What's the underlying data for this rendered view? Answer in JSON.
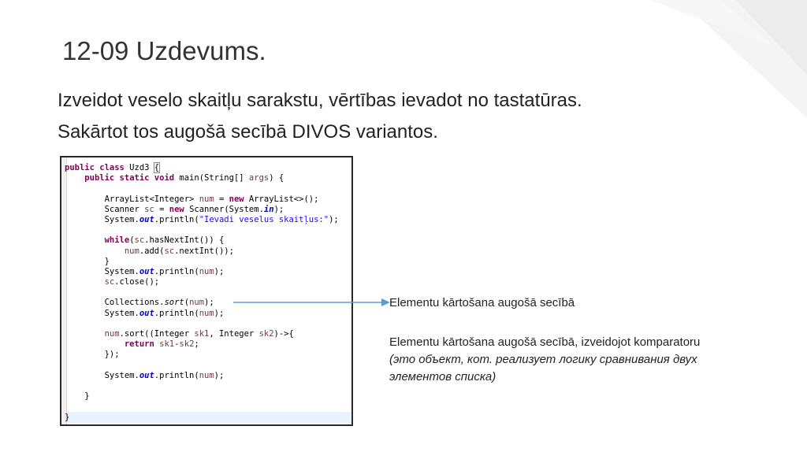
{
  "slide": {
    "title": "12-09 Uzdevums.",
    "paragraphs": [
      "Izveidot veselo skaitļu sarakstu, vērtības ievadot no tastatūras.",
      "Sakārtot tos augošā secībā DIVOS variantos."
    ]
  },
  "code": {
    "lines": [
      [
        {
          "t": "public class",
          "c": "kw"
        },
        {
          "t": " Uzd3 "
        },
        {
          "t": "{",
          "c": "brk"
        }
      ],
      [
        {
          "t": "    "
        },
        {
          "t": "public static void",
          "c": "kw"
        },
        {
          "t": " main(String[] "
        },
        {
          "t": "args",
          "c": "var"
        },
        {
          "t": ") {"
        }
      ],
      [],
      [
        {
          "t": "        ArrayList<Integer> "
        },
        {
          "t": "num",
          "c": "var"
        },
        {
          "t": " = "
        },
        {
          "t": "new",
          "c": "kw"
        },
        {
          "t": " ArrayList<>();"
        }
      ],
      [
        {
          "t": "        Scanner "
        },
        {
          "t": "sc",
          "c": "var"
        },
        {
          "t": " = "
        },
        {
          "t": "new",
          "c": "kw"
        },
        {
          "t": " Scanner(System."
        },
        {
          "t": "in",
          "c": "fld"
        },
        {
          "t": ");"
        }
      ],
      [
        {
          "t": "        System."
        },
        {
          "t": "out",
          "c": "fld"
        },
        {
          "t": ".println("
        },
        {
          "t": "\"Ievadi veselus skaitļus:\"",
          "c": "str"
        },
        {
          "t": ");"
        }
      ],
      [],
      [
        {
          "t": "        "
        },
        {
          "t": "while",
          "c": "kw"
        },
        {
          "t": "("
        },
        {
          "t": "sc",
          "c": "var"
        },
        {
          "t": ".hasNextInt()) {"
        }
      ],
      [
        {
          "t": "            "
        },
        {
          "t": "num",
          "c": "var"
        },
        {
          "t": ".add("
        },
        {
          "t": "sc",
          "c": "var"
        },
        {
          "t": ".nextInt());"
        }
      ],
      [
        {
          "t": "        }"
        }
      ],
      [
        {
          "t": "        System."
        },
        {
          "t": "out",
          "c": "fld"
        },
        {
          "t": ".println("
        },
        {
          "t": "num",
          "c": "var"
        },
        {
          "t": ");"
        }
      ],
      [
        {
          "t": "        "
        },
        {
          "t": "sc",
          "c": "var"
        },
        {
          "t": ".close();"
        }
      ],
      [],
      [
        {
          "t": "        Collections."
        },
        {
          "t": "sort",
          "c": "ital"
        },
        {
          "t": "("
        },
        {
          "t": "num",
          "c": "var"
        },
        {
          "t": ");"
        }
      ],
      [
        {
          "t": "        System."
        },
        {
          "t": "out",
          "c": "fld"
        },
        {
          "t": ".println("
        },
        {
          "t": "num",
          "c": "var"
        },
        {
          "t": ");"
        }
      ],
      [],
      [
        {
          "t": "        "
        },
        {
          "t": "num",
          "c": "var"
        },
        {
          "t": ".sort((Integer "
        },
        {
          "t": "sk1",
          "c": "var"
        },
        {
          "t": ", Integer "
        },
        {
          "t": "sk2",
          "c": "var"
        },
        {
          "t": ")->{"
        }
      ],
      [
        {
          "t": "            "
        },
        {
          "t": "return",
          "c": "kw"
        },
        {
          "t": " "
        },
        {
          "t": "sk1",
          "c": "var"
        },
        {
          "t": "-"
        },
        {
          "t": "sk2",
          "c": "var"
        },
        {
          "t": ";"
        }
      ],
      [
        {
          "t": "        });"
        }
      ],
      [],
      [
        {
          "t": "        System."
        },
        {
          "t": "out",
          "c": "fld"
        },
        {
          "t": ".println("
        },
        {
          "t": "num",
          "c": "var"
        },
        {
          "t": ");"
        }
      ],
      [],
      [
        {
          "t": "    }"
        }
      ],
      [],
      [
        {
          "t": "}"
        }
      ]
    ]
  },
  "annotations": {
    "sort_label": "Elementu kārtošana augošā secībā",
    "comparator_label": "Elementu kārtošana augošā secībā, izveidojot komparatoru",
    "comparator_note_1": "(это объект, кот. реализует логику сравнивания двух",
    "comparator_note_2": "элементов списка)"
  },
  "colors": {
    "keyword": "#7f0055",
    "variable": "#6a3e3e",
    "string": "#2a00ff",
    "field": "#0000c0",
    "arrow": "#5b9bd5"
  }
}
